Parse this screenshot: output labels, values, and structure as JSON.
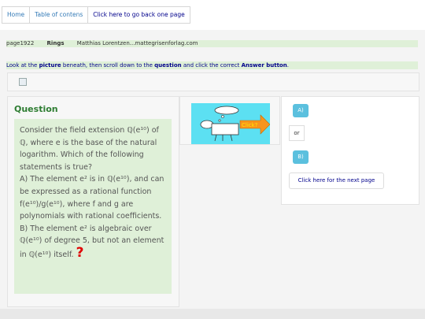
{
  "nav": {
    "home": "Home",
    "contents": "Table of contens",
    "back": "Click here to go back one page"
  },
  "info": {
    "page": "page1922",
    "title": "Rings",
    "author": "Matthias Lorentzen...mattegrisenforlag.com"
  },
  "instruction": {
    "t1": "Look at the ",
    "b1": "picture",
    "t2": " beneath, then scroll down to the ",
    "b2": "question",
    "t3": " and click the correct ",
    "b3": "Answer button",
    "t4": "."
  },
  "question": {
    "heading": "Question",
    "p1": "Consider the field extension ",
    "m1": "ℚ(e¹⁰)",
    "p2": " of ",
    "m2": "ℚ",
    "p3": ", where e is the base of the natural logarithm. Which of the following statements is true?",
    "a1": "A) The element ",
    "ma1": "e²",
    "a2": " is in ",
    "ma2": "ℚ(e¹⁰)",
    "a3": ", and can be expressed as a rational function ",
    "ma3": "f(e¹⁰)/g(e¹⁰)",
    "a4": ", where f and g are polynomials with rational coefficients.",
    "b1": "B) The element ",
    "mb1": "e²",
    "b2": " is algebraic over ",
    "mb2": "ℚ(e¹⁰)",
    "b3": " of degree 5, but not an element in ",
    "mb3": "ℚ(e¹⁰)",
    "b4": " itself.",
    "mark": "?"
  },
  "illustration": {
    "sign": "Click?",
    "background": "#5ce0f2"
  },
  "answers": {
    "a": "A)",
    "or": "or",
    "b": "B)",
    "next": "Click here for the next page"
  }
}
